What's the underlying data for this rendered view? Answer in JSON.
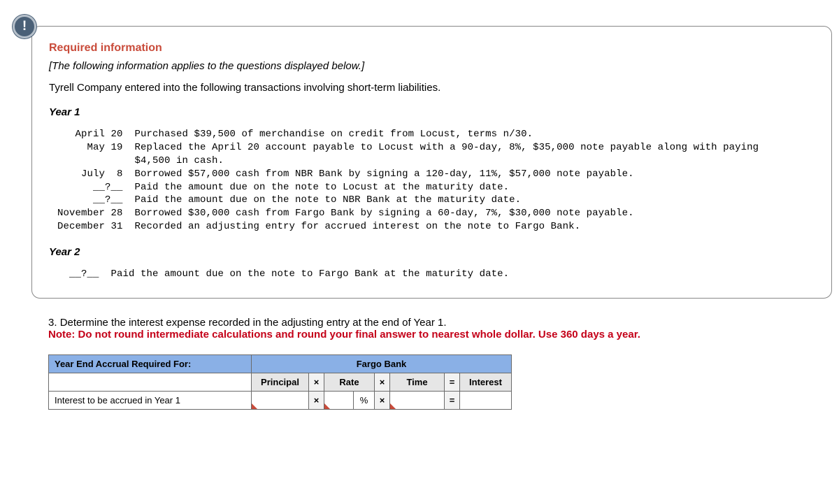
{
  "badge": "!",
  "required_info": {
    "title": "Required information",
    "applies": "[The following information applies to the questions displayed below.]",
    "intro": "Tyrell Company entered into the following transactions involving short-term liabilities.",
    "year1_head": "Year 1",
    "year2_head": "Year 2",
    "transactions_block": "   April 20  Purchased $39,500 of merchandise on credit from Locust, terms n/30.\n     May 19  Replaced the April 20 account payable to Locust with a 90-day, 8%, $35,000 note payable along with paying\n             $4,500 in cash.\n    July  8  Borrowed $57,000 cash from NBR Bank by signing a 120-day, 11%, $57,000 note payable.\n      __?__  Paid the amount due on the note to Locust at the maturity date.\n      __?__  Paid the amount due on the note to NBR Bank at the maturity date.\nNovember 28  Borrowed $30,000 cash from Fargo Bank by signing a 60-day, 7%, $30,000 note payable.\nDecember 31  Recorded an adjusting entry for accrued interest on the note to Fargo Bank.",
    "year2_block": "  __?__  Paid the amount due on the note to Fargo Bank at the maturity date."
  },
  "question": {
    "num": "3. ",
    "text": "Determine the interest expense recorded in the adjusting entry at the end of Year 1.",
    "note_label": "Note: ",
    "note_text": "Do not round intermediate calculations and round your final answer to nearest whole dollar. Use 360 days a year."
  },
  "table": {
    "header_left": "Year End Accrual Required For:",
    "header_right": "Fargo Bank",
    "col_principal": "Principal",
    "col_rate": "Rate",
    "col_time": "Time",
    "col_interest": "Interest",
    "row_label": "Interest to be accrued in Year 1",
    "times": "×",
    "equals": "=",
    "pct": "%"
  }
}
